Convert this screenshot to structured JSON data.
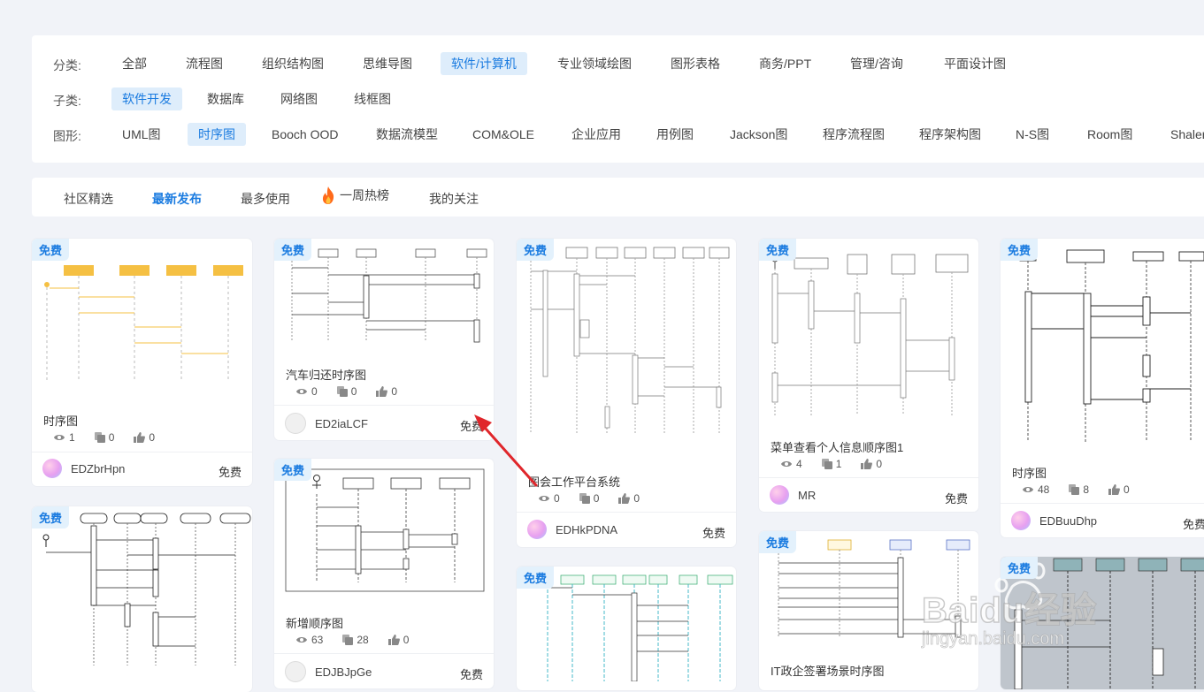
{
  "filters": {
    "category": {
      "label": "分类:",
      "items": [
        "全部",
        "流程图",
        "组织结构图",
        "思维导图",
        "软件/计算机",
        "专业领域绘图",
        "图形表格",
        "商务/PPT",
        "管理/咨询",
        "平面设计图"
      ],
      "active": "软件/计算机"
    },
    "subcategory": {
      "label": "子类:",
      "items": [
        "软件开发",
        "数据库",
        "网络图",
        "线框图"
      ],
      "active": "软件开发"
    },
    "shape": {
      "label": "图形:",
      "items": [
        "UML图",
        "时序图",
        "Booch OOD",
        "数据流模型",
        "COM&OLE",
        "企业应用",
        "用例图",
        "Jackson图",
        "程序流程图",
        "程序架构图",
        "N-S图",
        "Room图",
        "Shaler"
      ],
      "active": "时序图"
    }
  },
  "tabs": {
    "items": [
      "社区精选",
      "最新发布",
      "最多使用",
      "一周热榜",
      "我的关注"
    ],
    "active": "最新发布"
  },
  "cards": [
    {
      "badge": "免费",
      "title": "时序图",
      "views": "1",
      "copies": "0",
      "likes": "0",
      "author": "EDZbrHpn",
      "price": "免费"
    },
    {
      "badge": "免费",
      "title": "汽车归还时序图",
      "views": "0",
      "copies": "0",
      "likes": "0",
      "author": "ED2iaLCF",
      "price": "免费"
    },
    {
      "badge": "免费",
      "title": "图会工作平台系统",
      "views": "0",
      "copies": "0",
      "likes": "0",
      "author": "EDHkPDNA",
      "price": "免费"
    },
    {
      "badge": "免费",
      "title": "菜单查看个人信息顺序图1",
      "views": "4",
      "copies": "1",
      "likes": "0",
      "author": "MR",
      "price": "免费"
    },
    {
      "badge": "免费",
      "title": "时序图",
      "views": "48",
      "copies": "8",
      "likes": "0",
      "author": "EDBuuDhp",
      "price": "免费"
    },
    {
      "badge": "免费",
      "title": "新增顺序图",
      "views": "63",
      "copies": "28",
      "likes": "0",
      "author": "EDJBJpGe",
      "price": "免费"
    },
    {
      "badge": "免费",
      "title": "IT政企签署场景时序图"
    },
    {
      "badge": "免费"
    },
    {
      "badge": "免费"
    },
    {
      "badge": "免费"
    }
  ],
  "watermark": {
    "brand": "Baidu经验",
    "url": "jingyan.baidu.com"
  },
  "colors": {
    "accent": "#1a7be0",
    "active_bg": "#deedfb",
    "annotation_arrow": "#e0262b"
  }
}
